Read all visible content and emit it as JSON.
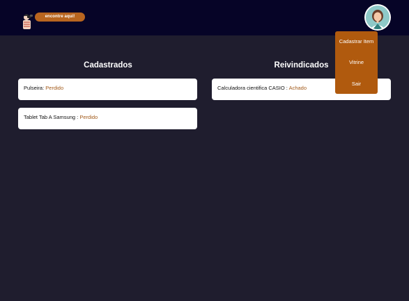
{
  "header": {
    "logo_text": "encontre aqui!",
    "colors": {
      "bar": "#060427",
      "logo_pill": "#b8651f"
    }
  },
  "menu": {
    "items": [
      {
        "label": "Cadastrar Item"
      },
      {
        "label": "Vitrine"
      },
      {
        "label": "Sair"
      }
    ],
    "color": "#b05a0e"
  },
  "sections": {
    "cadastrados": {
      "title": "Cadastrados",
      "items": [
        {
          "name": "Pulseira",
          "sep": ": ",
          "status": "Perdido"
        },
        {
          "name": "Tablet Tab A Samsung",
          "sep": " : ",
          "status": "Perdido"
        }
      ]
    },
    "reivindicados": {
      "title": "Reivindicados",
      "items": [
        {
          "name": "Calculadora cientifica CASIO",
          "sep": " : ",
          "status": "Achado"
        }
      ]
    }
  },
  "theme": {
    "background": "#1f1d2e",
    "status_color": "#a25a1a"
  }
}
